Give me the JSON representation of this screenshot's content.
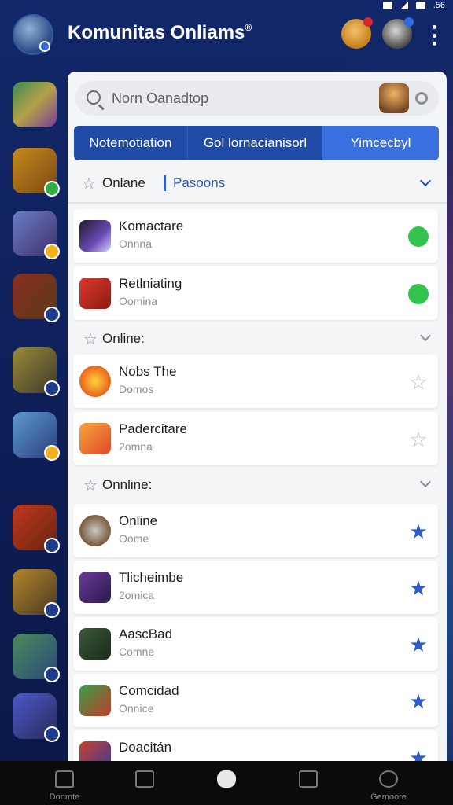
{
  "status_bar": {
    "battery": ".56"
  },
  "header": {
    "title": "Komunitas Onliams",
    "title_mark": "®"
  },
  "search": {
    "placeholder": "Norn Oanadtop"
  },
  "tabs": [
    {
      "label": "Notemotiation",
      "active": false
    },
    {
      "label": "Gol lornacianisorl",
      "active": false
    },
    {
      "label": "Yimcecbyl",
      "active": true
    }
  ],
  "filter": {
    "online_label": "Onlane",
    "persons_label": "Pasoons"
  },
  "cards": [
    {
      "name": "Komactare",
      "sub": "Onnna",
      "icon": "game-thumb-1",
      "action": "green-status-icon"
    },
    {
      "name": "Retlniating",
      "sub": "Oomina",
      "icon": "game-thumb-2",
      "action": "smile-status-icon"
    },
    {
      "name": "Nobs The",
      "sub": "Domos",
      "icon": "game-thumb-3",
      "action": "star-outline-icon"
    },
    {
      "name": "Padercitare",
      "sub": "2omna",
      "icon": "game-thumb-4",
      "action": "star-outline-icon"
    },
    {
      "name": "Online",
      "sub": "Oome",
      "icon": "game-thumb-5",
      "action": "star-filled-icon"
    },
    {
      "name": "Tlicheimbe",
      "sub": "2omica",
      "icon": "game-thumb-6",
      "action": "star-filled-icon"
    },
    {
      "name": "AascBad",
      "sub": "Comne",
      "icon": "game-thumb-7",
      "action": "star-filled-icon"
    },
    {
      "name": "Comcidad",
      "sub": "Onnice",
      "icon": "game-thumb-8",
      "action": "star-filled-icon"
    },
    {
      "name": "Doacitán",
      "sub": "",
      "icon": "game-thumb-9",
      "action": "star-filled-icon"
    }
  ],
  "sections": [
    {
      "label": "Online:"
    },
    {
      "label": "Onnline:"
    }
  ],
  "bottom_nav": [
    {
      "label": "Donmte",
      "icon": "home-icon"
    },
    {
      "label": "",
      "icon": "square-icon"
    },
    {
      "label": "",
      "icon": "blob-icon"
    },
    {
      "label": "",
      "icon": "edit-icon"
    },
    {
      "label": "Gemoore",
      "icon": "gamepad-icon"
    }
  ],
  "colors": {
    "accent_blue": "#1f4aa6",
    "active_tab": "#3a6fe0",
    "online_green": "#33c24d",
    "star_blue": "#2d5ccc",
    "background": "#0f1f52"
  }
}
